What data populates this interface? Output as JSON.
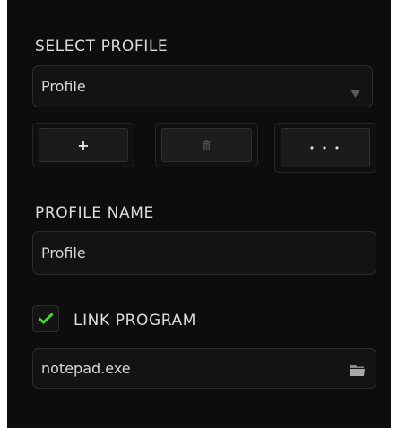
{
  "select_profile": {
    "heading": "SELECT PROFILE",
    "selected_value": "Profile",
    "dropdown_icon": "triangle-down-icon"
  },
  "profile_buttons": {
    "add_label": "+",
    "delete_icon": "trash-icon",
    "more_label": "• • •"
  },
  "profile_name": {
    "heading": "PROFILE NAME",
    "value": "Profile"
  },
  "link_program": {
    "label": "LINK PROGRAM",
    "checked": true,
    "value": "notepad.exe",
    "browse_icon": "folder-icon"
  },
  "colors": {
    "background": "#0d0d0d",
    "accent_green": "#44d62c",
    "text": "#dcdcdc"
  }
}
